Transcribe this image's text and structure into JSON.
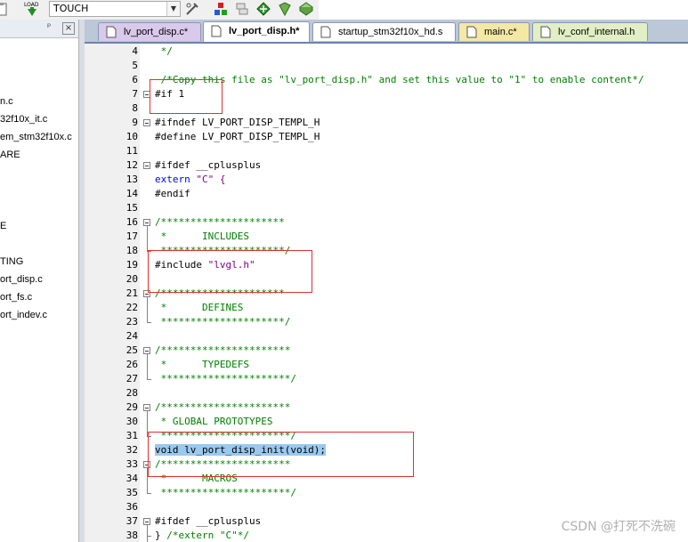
{
  "toolbar": {
    "load_label": "LOAD",
    "target_value": "TOUCH",
    "icons": [
      "clipboard-icon",
      "load-icon",
      "target-options-icon",
      "manage-components-icon",
      "batch-build-icon",
      "diamond-icon",
      "shield-icon",
      "package-icon"
    ]
  },
  "project_panel": {
    "pin": "ᵖ",
    "close": "×",
    "items": [
      {
        "label": "n.c"
      },
      {
        "label": "32f10x_it.c"
      },
      {
        "label": "em_stm32f10x.c"
      },
      {
        "label": "ARE"
      },
      {
        "label": "E"
      },
      {
        "label": "TING"
      },
      {
        "label": "ort_disp.c"
      },
      {
        "label": "ort_fs.c"
      },
      {
        "label": "ort_indev.c"
      }
    ]
  },
  "tabs": [
    {
      "label": "lv_port_disp.c*",
      "color": "#d9c9ea"
    },
    {
      "label": "lv_port_disp.h*",
      "color": "#ffffff"
    },
    {
      "label": "startup_stm32f10x_hd.s",
      "color": "#ffffff"
    },
    {
      "label": "main.c*",
      "color": "#f3e9a4"
    },
    {
      "label": "lv_conf_internal.h",
      "color": "#e2efc4"
    }
  ],
  "editor": {
    "line_numbers": [
      "4",
      "5",
      "6",
      "7",
      "8",
      "9",
      "10",
      "11",
      "12",
      "13",
      "14",
      "15",
      "16",
      "17",
      "18",
      "19",
      "20",
      "21",
      "22",
      "23",
      "24",
      "25",
      "26",
      "27",
      "28",
      "29",
      "30",
      "31",
      "32",
      "33",
      "34",
      "35",
      "36",
      "37",
      "38"
    ],
    "lines": [
      [
        {
          "t": " */",
          "c": "comment"
        }
      ],
      [],
      [
        {
          "t": " /*Copy this file as \"lv_port_disp.h\" and set this value to \"1\" to enable content*/",
          "c": "comment"
        }
      ],
      [
        {
          "t": "#if 1",
          "c": "plain"
        }
      ],
      [],
      [
        {
          "t": "#ifndef LV_PORT_DISP_TEMPL_H",
          "c": "plain"
        }
      ],
      [
        {
          "t": "#define LV_PORT_DISP_TEMPL_H",
          "c": "plain"
        }
      ],
      [],
      [
        {
          "t": "#ifdef __cplusplus",
          "c": "plain"
        }
      ],
      [
        {
          "t": "extern",
          "c": "kw"
        },
        {
          "t": " \"C\" {",
          "c": "str"
        }
      ],
      [
        {
          "t": "#endif",
          "c": "plain"
        }
      ],
      [],
      [
        {
          "t": "/*********************",
          "c": "comment"
        }
      ],
      [
        {
          "t": " *      INCLUDES",
          "c": "comment"
        }
      ],
      [
        {
          "t": " *********************/",
          "c": "comment"
        }
      ],
      [
        {
          "t": "#include ",
          "c": "plain"
        },
        {
          "t": "\"lvgl.h\"",
          "c": "str"
        }
      ],
      [],
      [
        {
          "t": "/*********************",
          "c": "comment"
        }
      ],
      [
        {
          "t": " *      DEFINES",
          "c": "comment"
        }
      ],
      [
        {
          "t": " *********************/",
          "c": "comment"
        }
      ],
      [],
      [
        {
          "t": "/**********************",
          "c": "comment"
        }
      ],
      [
        {
          "t": " *      TYPEDEFS",
          "c": "comment"
        }
      ],
      [
        {
          "t": " **********************/",
          "c": "comment"
        }
      ],
      [],
      [
        {
          "t": "/**********************",
          "c": "comment"
        }
      ],
      [
        {
          "t": " * GLOBAL PROTOTYPES",
          "c": "comment"
        }
      ],
      [
        {
          "t": " **********************/",
          "c": "comment"
        }
      ],
      [
        {
          "t": "void lv_port_disp_init(void);",
          "c": "sel"
        }
      ],
      [
        {
          "t": "/**********************",
          "c": "comment"
        }
      ],
      [
        {
          "t": " *      MACROS",
          "c": "comment"
        }
      ],
      [
        {
          "t": " **********************/",
          "c": "comment"
        }
      ],
      [],
      [
        {
          "t": "#ifdef __cplusplus",
          "c": "plain"
        }
      ],
      [
        {
          "t": "} ",
          "c": "plain"
        },
        {
          "t": "/*extern \"C\"*/",
          "c": "comment"
        }
      ]
    ]
  },
  "watermark": "CSDN @打死不洗碗"
}
